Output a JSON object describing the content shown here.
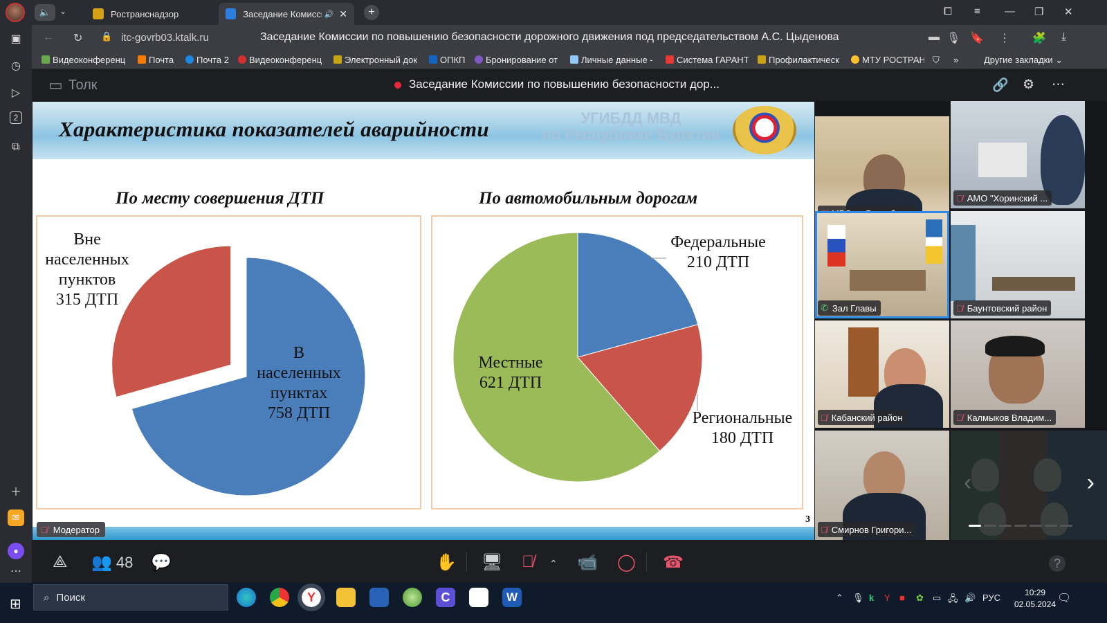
{
  "browser": {
    "tabs": [
      {
        "label": "Ространснадзор",
        "active": false
      },
      {
        "label": "Заседание Комисси",
        "active": true
      }
    ],
    "url": "itc-govrb03.ktalk.ru",
    "page_title": "Заседание Комиссии по повышению безопасности дорожного движения под председательством А.С. Цыденова",
    "bookmarks": [
      "Видеоконференц",
      "Почта",
      "Почта 2",
      "Видеоконференц",
      "Электронный док",
      "ОПКП",
      "Бронирование от",
      "Личные данные -",
      "Система ГАРАНТ",
      "Профилактическ",
      "МТУ РОСТРАН"
    ],
    "bookmarks_more": "»",
    "other_bookmarks": "Другие закладки",
    "rail_badge": "2"
  },
  "app": {
    "logo_label": "Толк",
    "meeting_title": "Заседание Комиссии по повышению безопасности дор...",
    "moderator_label": "Модератор",
    "participants_count": "48"
  },
  "slide": {
    "title": "Характеристика показателей аварийности",
    "agency_line1": "УГИБДД МВД",
    "agency_line2": "по Республике Бурятия",
    "page_number": "3"
  },
  "chart_data": [
    {
      "type": "pie",
      "title": "По месту совершения ДТП",
      "categories": [
        "В населенных пунктах",
        "Вне населенных пунктов"
      ],
      "values": [
        758,
        315
      ],
      "label_lines": [
        [
          "В",
          "населенных",
          "пунктах",
          "758 ДТП"
        ],
        [
          "Вне",
          "населенных",
          "пунктов",
          "315 ДТП"
        ]
      ],
      "colors": [
        "#4a7ebb",
        "#c9554a"
      ],
      "exploded": "Вне населенных пунктов"
    },
    {
      "type": "pie",
      "title": "По автомобильным дорогам",
      "categories": [
        "Федеральные",
        "Региональные",
        "Местные"
      ],
      "values": [
        210,
        180,
        621
      ],
      "label_lines": [
        [
          "Федеральные",
          "210 ДТП"
        ],
        [
          "Региональные",
          "180 ДТП"
        ],
        [
          "Местные",
          "621 ДТП"
        ]
      ],
      "colors": [
        "#4a7ebb",
        "#c9554a",
        "#9bbb59"
      ]
    }
  ],
  "participants": [
    {
      "name": "МВД по Республи...",
      "muted": true
    },
    {
      "name": "АМО \"Хоринский ...",
      "muted": true
    },
    {
      "name": "Зал Главы",
      "muted": false
    },
    {
      "name": "Баунтовский район",
      "muted": true
    },
    {
      "name": "Кабанский район",
      "muted": true
    },
    {
      "name": "Калмыков Владим...",
      "muted": true
    },
    {
      "name": "Смирнов Григори...",
      "muted": true
    }
  ],
  "taskbar": {
    "search_placeholder": "Поиск",
    "lang": "РУС",
    "time": "10:29",
    "date": "02.05.2024"
  }
}
